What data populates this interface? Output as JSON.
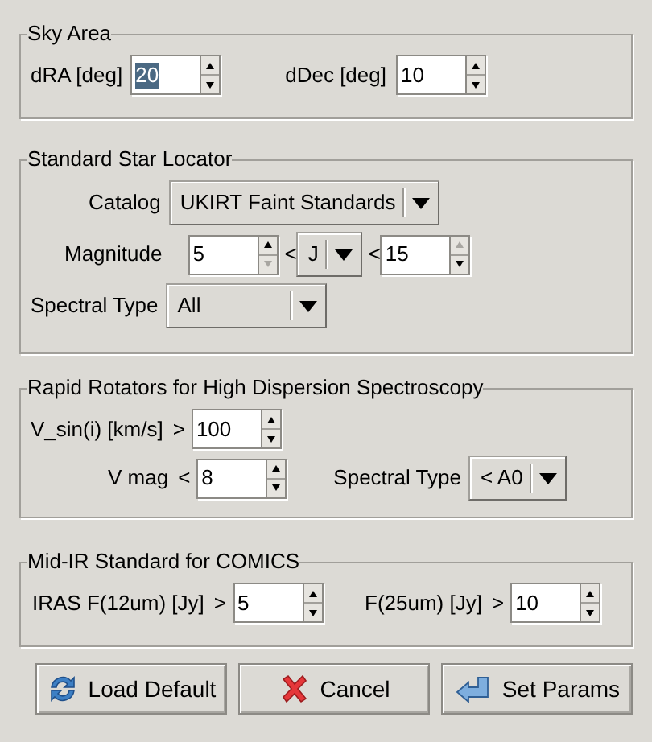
{
  "groups": [
    {
      "title": "Sky Area",
      "rows": [
        [
          {
            "kind": "label",
            "text": "dRA [deg]"
          },
          {
            "kind": "spin",
            "value": "20",
            "selected": true
          },
          {
            "kind": "label",
            "text": "dDec [deg]"
          },
          {
            "kind": "spin",
            "value": "10",
            "selected": false
          }
        ]
      ]
    },
    {
      "title": "Standard Star Locator",
      "rows": [
        [
          {
            "kind": "label",
            "text": "Catalog"
          },
          {
            "kind": "combo",
            "value": "UKIRT Faint Standards"
          }
        ],
        [
          {
            "kind": "label",
            "text": "Magnitude"
          },
          {
            "kind": "spin",
            "value": "5",
            "selected": false,
            "at_min": true
          },
          {
            "kind": "op",
            "text": "<"
          },
          {
            "kind": "combo",
            "value": "J"
          },
          {
            "kind": "op",
            "text": "<"
          },
          {
            "kind": "spin",
            "value": "15",
            "selected": false,
            "at_max": true
          }
        ],
        [
          {
            "kind": "label",
            "text": "Spectral Type"
          },
          {
            "kind": "combo",
            "value": "All"
          }
        ]
      ]
    },
    {
      "title": "Rapid Rotators for High Dispersion Spectroscopy",
      "rows": [
        [
          {
            "kind": "label",
            "text": "V_sin(i) [km/s]"
          },
          {
            "kind": "op",
            "text": ">"
          },
          {
            "kind": "spin",
            "value": "100",
            "selected": false
          }
        ],
        [
          {
            "kind": "label",
            "text": "V mag"
          },
          {
            "kind": "op",
            "text": "<"
          },
          {
            "kind": "spin",
            "value": "8",
            "selected": false
          },
          {
            "kind": "label",
            "text": "Spectral Type"
          },
          {
            "kind": "combo",
            "value": "< A0"
          }
        ]
      ]
    },
    {
      "title": "Mid-IR Standard for COMICS",
      "rows": [
        [
          {
            "kind": "label",
            "text": "IRAS F(12um) [Jy]"
          },
          {
            "kind": "op",
            "text": ">"
          },
          {
            "kind": "spin",
            "value": "5",
            "selected": false
          },
          {
            "kind": "label",
            "text": "F(25um) [Jy]"
          },
          {
            "kind": "op",
            "text": ">"
          },
          {
            "kind": "spin",
            "value": "10",
            "selected": false
          }
        ]
      ]
    }
  ],
  "buttons": [
    {
      "kind": "reload",
      "label": "Load Default"
    },
    {
      "kind": "cancel",
      "label": "Cancel"
    },
    {
      "kind": "apply",
      "label": "Set Params"
    }
  ]
}
